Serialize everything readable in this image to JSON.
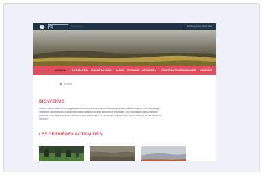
{
  "topbar": {
    "search_placeholder": "Rechercher...",
    "language_switch": "FRANÇAIS | ENGLISH"
  },
  "nav": {
    "items": [
      {
        "label": "ACCUEIL",
        "active": true
      },
      {
        "label": "ACTUALITÉS",
        "active": false
      },
      {
        "label": "PLAN D'ACTIONS",
        "active": false
      },
      {
        "label": "ALPES",
        "active": false
      },
      {
        "label": "TERRAINS",
        "active": false
      },
      {
        "label": "ATELIERS ▾",
        "active": false
      },
      {
        "label": "CONTRIBUTEURS",
        "active": false
      },
      {
        "label": "ANNUAIRE",
        "active": false
      },
      {
        "label": "CONTACT",
        "active": false
      }
    ]
  },
  "breadcrumb": "Accueil",
  "welcome": {
    "title": "BIENVENUE",
    "lines": [
      "Lorsqu'il est en outil d'accompagnement et de suivi des démarches de développement durable, l'espace Vivre et partager,",
      "l'ensemble peut offrir aux collectivités locales dans le cadre de démarches territoriales, aux aménagements du territoire",
      "public ou privé dans le cadre de démarche plus collectives. Pour en savoir plus sur l'outil, rendez-vous sur le site officiel de",
      "l'ADEME."
    ]
  },
  "news": {
    "title": "LES DERNIÈRES ACTUALITÉS"
  },
  "colors": {
    "topbar": "#1f3447",
    "nav": "#e04f5f",
    "accent": "#e04f5f",
    "frame_bg": "#eef1f8"
  },
  "icons": {
    "print": "print-icon",
    "search": "search-icon",
    "home": "home-icon"
  }
}
